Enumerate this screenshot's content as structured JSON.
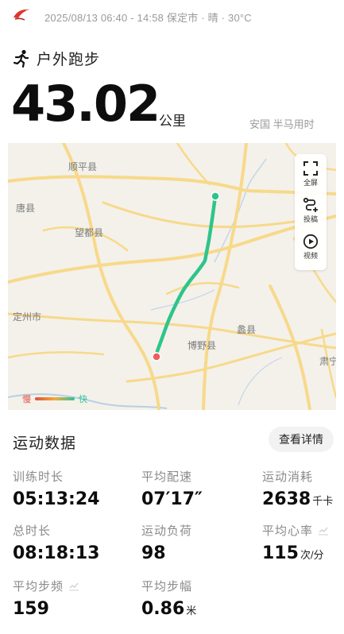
{
  "header": {
    "meta": "2025/08/13 06:40 - 14:58 保定市 · 晴 · 30°C"
  },
  "activity": {
    "label": "户外跑步",
    "distance": "43.02",
    "distance_unit": "公里",
    "achievement": "安国 半马用时"
  },
  "map": {
    "labels": {
      "shunping": "顺平县",
      "tang": "唐县",
      "wangdu": "望都县",
      "dingzhou": "定州市",
      "boye": "博野县",
      "li": "蠡县",
      "su": "肃宁"
    },
    "tools": {
      "fullscreen": "全屏",
      "submit": "投稿",
      "video": "视频"
    },
    "legend": {
      "slow": "慢",
      "fast": "快"
    },
    "colors": {
      "route": "#2fc48b",
      "start": "#2fc48b",
      "end": "#ef5e5e",
      "road": "#f8d98a"
    }
  },
  "stats": {
    "title": "运动数据",
    "details_button": "查看详情",
    "items": [
      {
        "label": "训练时长",
        "value": "05:13:24",
        "unit": ""
      },
      {
        "label": "平均配速",
        "value": "07′17″",
        "unit": ""
      },
      {
        "label": "运动消耗",
        "value": "2638",
        "unit": "千卡"
      },
      {
        "label": "总时长",
        "value": "08:18:13",
        "unit": ""
      },
      {
        "label": "运动负荷",
        "value": "98",
        "unit": ""
      },
      {
        "label": "平均心率",
        "value": "115",
        "unit": "次/分"
      },
      {
        "label": "平均步频",
        "value": "159",
        "unit": ""
      },
      {
        "label": "平均步幅",
        "value": "0.86",
        "unit": "米"
      }
    ]
  }
}
